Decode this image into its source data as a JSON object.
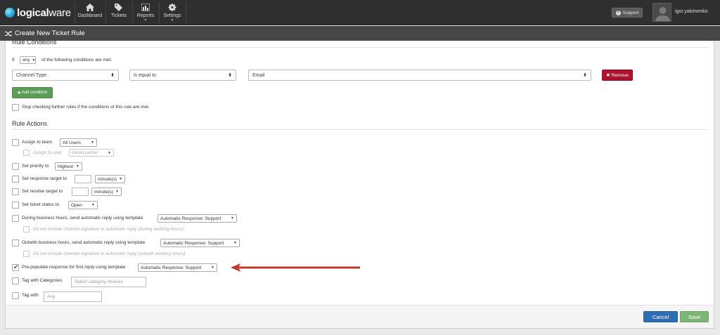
{
  "brand": {
    "logo_bold": "logical",
    "logo_light": "ware"
  },
  "nav": {
    "dashboard": "Dashboard",
    "tickets": "Tickets",
    "reports": "Reports",
    "settings": "Settings"
  },
  "header": {
    "support_label": "Support",
    "username": "igor.yakimenko"
  },
  "page": {
    "title": "Create New Ticket Rule"
  },
  "conditions": {
    "section_title": "Rule Conditions",
    "if_label": "If",
    "match_value": "any",
    "match_suffix": "of the following conditions are met:",
    "row": {
      "field": "Channel Type",
      "operator": "is equal to",
      "value": "Email"
    },
    "remove_label": "Remove",
    "add_label": "Add condition",
    "stop_label": "Stop checking further rules if the conditions of this rule are met."
  },
  "actions": {
    "section_title": "Rule Actions",
    "assign_team_label": "Assign to team",
    "assign_team_value": "All Users",
    "assign_user_label": "Assign to user",
    "assign_user_value": "daniel.parker",
    "priority_label": "Set priority to",
    "priority_value": "Highest",
    "response_target_label": "Set response target to",
    "response_unit": "minute(s)",
    "resolve_target_label": "Set resolve target to",
    "resolve_unit": "minute(s)",
    "status_label": "Set ticket status to",
    "status_value": "Open",
    "business_hours_label": "During business hours, send automatic reply using template",
    "business_hours_template": "Automatic Response: Support",
    "business_hours_sig": "Do not include channel signature in automatic reply (during working hours)",
    "outwith_hours_label": "Outwith business hours, send automatic reply using template",
    "outwith_hours_template": "Automatic Response: Support",
    "outwith_hours_sig": "Do not include channel signature in automatic reply (outwith working hours)",
    "prepopulate_label": "Pre-populate response for first reply using template",
    "prepopulate_template": "Automatic Response: Support",
    "tag_categories_label": "Tag with Categories:",
    "tag_categories_placeholder": "Select category choices",
    "tag_with_label": "Tag with",
    "tag_with_placeholder": "Any"
  },
  "footer": {
    "cancel_label": "Cancel",
    "save_label": "Save"
  },
  "colors": {
    "remove": "#b0112e",
    "add": "#5c9d56",
    "cancel": "#2e6eb5",
    "save": "#7db778",
    "annotation_arrow": "#c0392b"
  }
}
